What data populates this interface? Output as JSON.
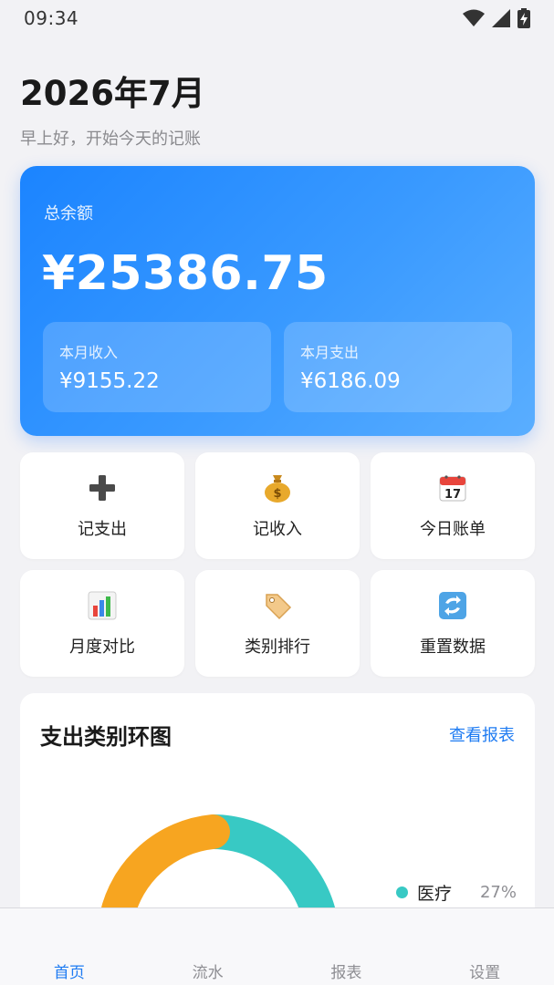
{
  "status_bar": {
    "time": "09:34"
  },
  "header": {
    "month": "2026年7月",
    "greeting": "早上好，开始今天的记账"
  },
  "balance": {
    "label": "总余额",
    "value": "¥25386.75",
    "income": {
      "label": "本月收入",
      "value": "¥9155.22"
    },
    "expense": {
      "label": "本月支出",
      "value": "¥6186.09"
    }
  },
  "actions": [
    {
      "label": "记支出",
      "icon": "plus-icon"
    },
    {
      "label": "记收入",
      "icon": "money-bag-icon"
    },
    {
      "label": "今日账单",
      "icon": "calendar-icon"
    },
    {
      "label": "月度对比",
      "icon": "bar-chart-icon"
    },
    {
      "label": "类别排行",
      "icon": "tag-icon"
    },
    {
      "label": "重置数据",
      "icon": "refresh-icon"
    }
  ],
  "expense_chart": {
    "title": "支出类别环图",
    "link": "查看报表",
    "legend": [
      {
        "name": "医疗",
        "percent": "27%",
        "color": "#38c9c4"
      }
    ],
    "segment_colors": [
      "#38c9c4",
      "#f7a520"
    ]
  },
  "tabs": [
    {
      "label": "首页",
      "active": true
    },
    {
      "label": "流水",
      "active": false
    },
    {
      "label": "报表",
      "active": false
    },
    {
      "label": "设置",
      "active": false
    }
  ],
  "colors": {
    "accent": "#1e7bf2",
    "card_gradient_start": "#1b84ff",
    "card_gradient_end": "#5aaeff"
  }
}
